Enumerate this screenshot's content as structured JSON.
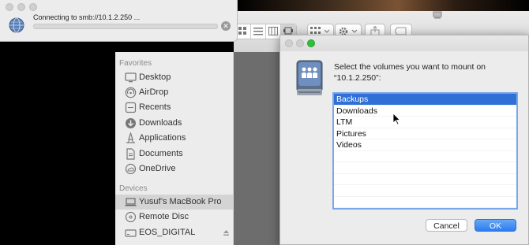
{
  "connecting": {
    "title": "Connecting to smb://10.1.2.250 ...",
    "globe_icon": "network-globe-icon",
    "stop_icon": "stop-icon"
  },
  "sidebar": {
    "favorites_header": "Favorites",
    "favorites": [
      {
        "label": "Desktop",
        "icon": "desktop-icon"
      },
      {
        "label": "AirDrop",
        "icon": "airdrop-icon"
      },
      {
        "label": "Recents",
        "icon": "clock-icon"
      },
      {
        "label": "Downloads",
        "icon": "download-icon"
      },
      {
        "label": "Applications",
        "icon": "applications-icon"
      },
      {
        "label": "Documents",
        "icon": "document-icon"
      },
      {
        "label": "OneDrive",
        "icon": "cloud-icon"
      }
    ],
    "devices_header": "Devices",
    "devices": [
      {
        "label": "Yusuf’s MacBook Pro",
        "icon": "laptop-icon",
        "selected": true
      },
      {
        "label": "Remote Disc",
        "icon": "disc-icon"
      },
      {
        "label": "EOS_DIGITAL",
        "icon": "drive-icon"
      }
    ]
  },
  "dialog": {
    "prompt": "Select the volumes you want to mount on “10.1.2.250”:",
    "volumes": [
      "Backups",
      "Downloads",
      "LTM",
      "Pictures",
      "Videos"
    ],
    "selected_volume": "Backups",
    "cancel_label": "Cancel",
    "ok_label": "OK"
  },
  "colors": {
    "selection_blue": "#2f6fd6",
    "ok_button_blue": "#2d7cf0",
    "traffic_light_green": "#2fbf3f"
  }
}
